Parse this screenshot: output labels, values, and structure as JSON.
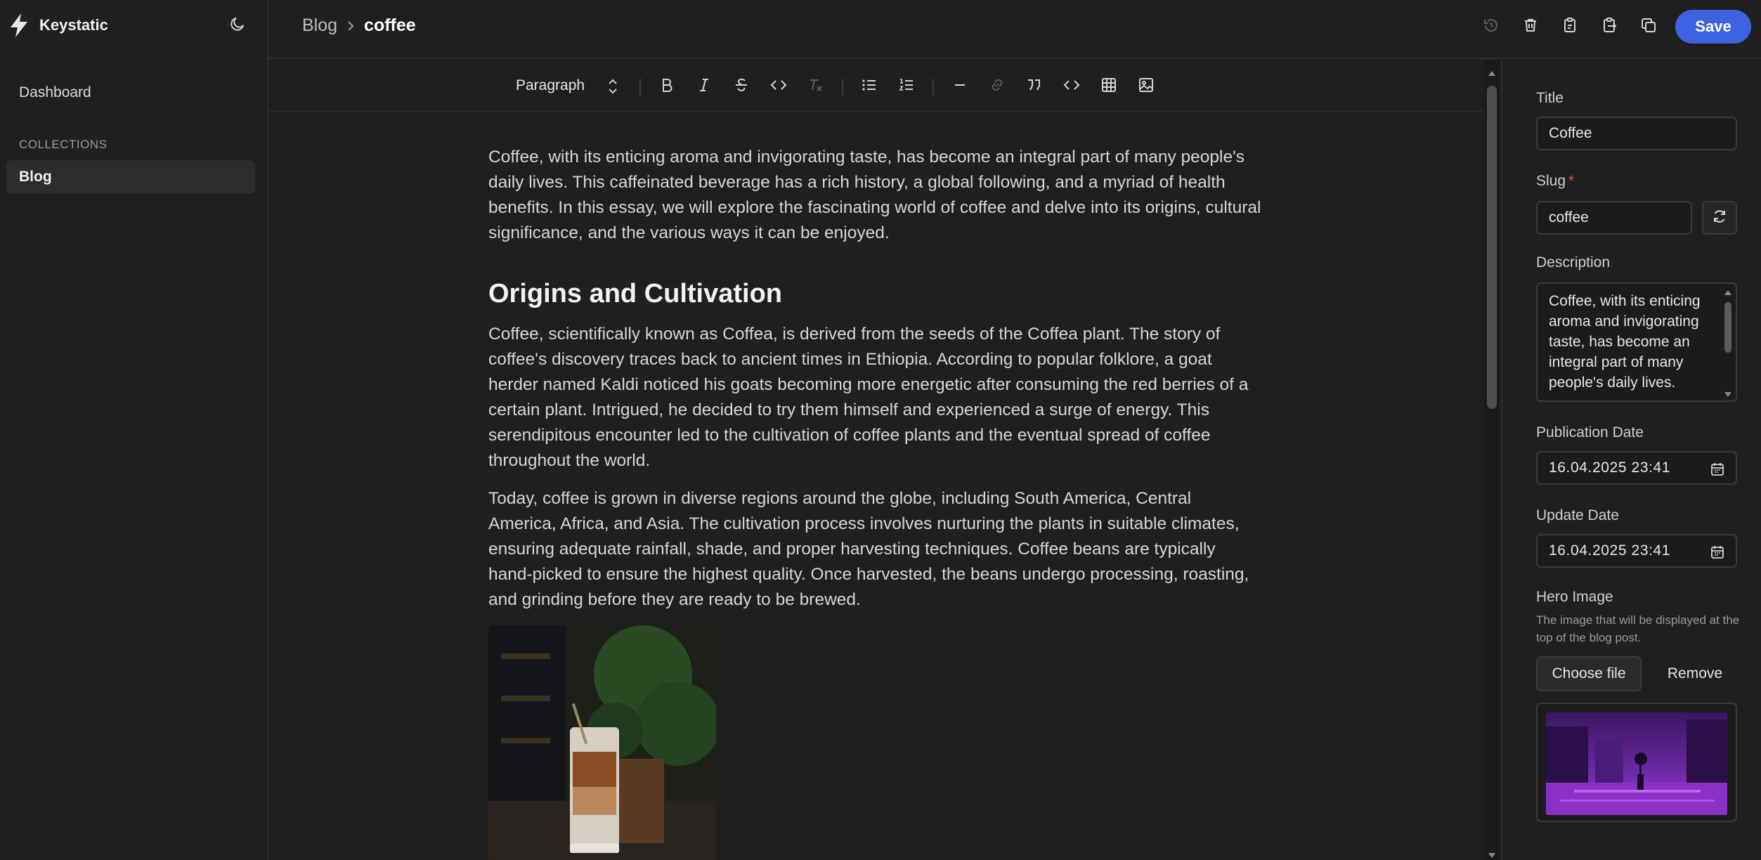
{
  "app": {
    "name": "Keystatic"
  },
  "sidebar": {
    "dashboard_label": "Dashboard",
    "section_label": "COLLECTIONS",
    "items": [
      {
        "label": "Blog",
        "active": true
      }
    ]
  },
  "header": {
    "breadcrumb": {
      "parent": "Blog",
      "current": "coffee"
    },
    "actions": [
      "history-icon",
      "trash-icon",
      "copy-icon",
      "paste-icon",
      "duplicate-icon"
    ],
    "save_label": "Save"
  },
  "toolbar": {
    "block_type": "Paragraph",
    "buttons": [
      "bold",
      "italic",
      "strikethrough",
      "code",
      "clear-formatting",
      "bullet-list",
      "numbered-list",
      "divider",
      "link",
      "blockquote",
      "code-block",
      "table",
      "image"
    ]
  },
  "document": {
    "intro": "Coffee, with its enticing aroma and invigorating taste, has become an integral part of many people's daily lives. This caffeinated beverage has a rich history, a global following, and a myriad of health benefits. In this essay, we will explore the fascinating world of coffee and delve into its origins, cultural significance, and the various ways it can be enjoyed.",
    "heading": "Origins and Cultivation",
    "p1": "Coffee, scientifically known as Coffea, is derived from the seeds of the Coffea plant. The story of coffee's discovery traces back to ancient times in Ethiopia. According to popular folklore, a goat herder named Kaldi noticed his goats becoming more energetic after consuming the red berries of a certain plant. Intrigued, he decided to try them himself and experienced a surge of energy. This serendipitous encounter led to the cultivation of coffee plants and the eventual spread of coffee throughout the world.",
    "p2": "Today, coffee is grown in diverse regions around the globe, including South America, Central America, Africa, and Asia. The cultivation process involves nurturing the plants in suitable climates, ensuring adequate rainfall, shade, and proper harvesting techniques. Coffee beans are typically hand-picked to ensure the highest quality. Once harvested, the beans undergo processing, roasting, and grinding before they are ready to be brewed."
  },
  "fields": {
    "title": {
      "label": "Title",
      "value": "Coffee"
    },
    "slug": {
      "label": "Slug",
      "required_mark": "*",
      "value": "coffee"
    },
    "description": {
      "label": "Description",
      "value": "Coffee, with its enticing aroma and invigorating taste, has become an integral part of many people's daily lives."
    },
    "publication_date": {
      "label": "Publication Date",
      "value": "16.04.2025 23:41"
    },
    "update_date": {
      "label": "Update Date",
      "value": "16.04.2025 23:41"
    },
    "hero_image": {
      "label": "Hero Image",
      "hint": "The image that will be displayed at the top of the blog post.",
      "choose_label": "Choose file",
      "remove_label": "Remove"
    }
  },
  "colors": {
    "accent": "#3d62e0",
    "background": "#1f1f1f",
    "required": "#e5484d"
  }
}
